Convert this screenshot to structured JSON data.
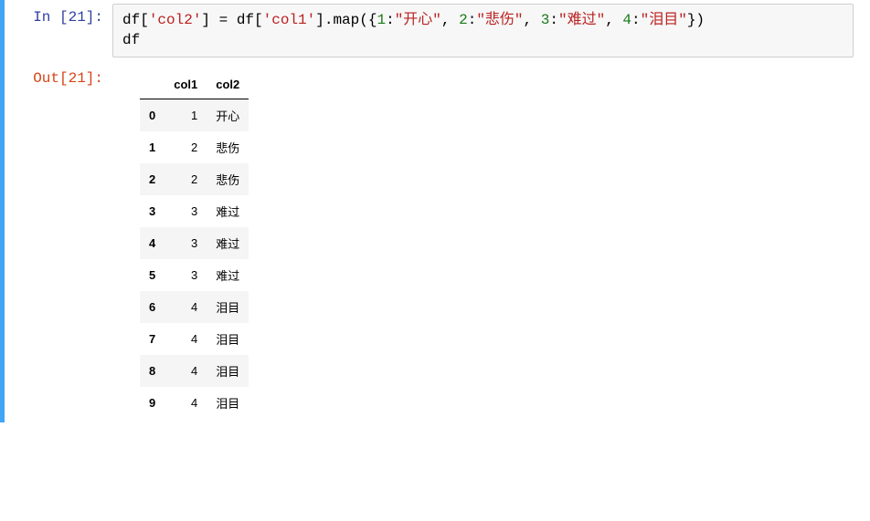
{
  "in_prompt": "In  [21]:",
  "out_prompt": "Out[21]:",
  "code_tokens": [
    {
      "t": "df["
    },
    {
      "t": "'col2'",
      "cls": "tok-str"
    },
    {
      "t": "] = df["
    },
    {
      "t": "'col1'",
      "cls": "tok-str"
    },
    {
      "t": "].map({"
    },
    {
      "t": "1",
      "cls": "tok-num"
    },
    {
      "t": ":"
    },
    {
      "t": "\"开心\"",
      "cls": "tok-str"
    },
    {
      "t": ", "
    },
    {
      "t": "2",
      "cls": "tok-num"
    },
    {
      "t": ":"
    },
    {
      "t": "\"悲伤\"",
      "cls": "tok-str"
    },
    {
      "t": ", "
    },
    {
      "t": "3",
      "cls": "tok-num"
    },
    {
      "t": ":"
    },
    {
      "t": "\"难过\"",
      "cls": "tok-str"
    },
    {
      "t": ", "
    },
    {
      "t": "4",
      "cls": "tok-num"
    },
    {
      "t": ":"
    },
    {
      "t": "\"泪目\"",
      "cls": "tok-str"
    },
    {
      "t": "})\ndf"
    }
  ],
  "table": {
    "headers": [
      "",
      "col1",
      "col2"
    ],
    "rows": [
      {
        "idx": "0",
        "col1": "1",
        "col2": "开心"
      },
      {
        "idx": "1",
        "col1": "2",
        "col2": "悲伤"
      },
      {
        "idx": "2",
        "col1": "2",
        "col2": "悲伤"
      },
      {
        "idx": "3",
        "col1": "3",
        "col2": "难过"
      },
      {
        "idx": "4",
        "col1": "3",
        "col2": "难过"
      },
      {
        "idx": "5",
        "col1": "3",
        "col2": "难过"
      },
      {
        "idx": "6",
        "col1": "4",
        "col2": "泪目"
      },
      {
        "idx": "7",
        "col1": "4",
        "col2": "泪目"
      },
      {
        "idx": "8",
        "col1": "4",
        "col2": "泪目"
      },
      {
        "idx": "9",
        "col1": "4",
        "col2": "泪目"
      }
    ]
  }
}
